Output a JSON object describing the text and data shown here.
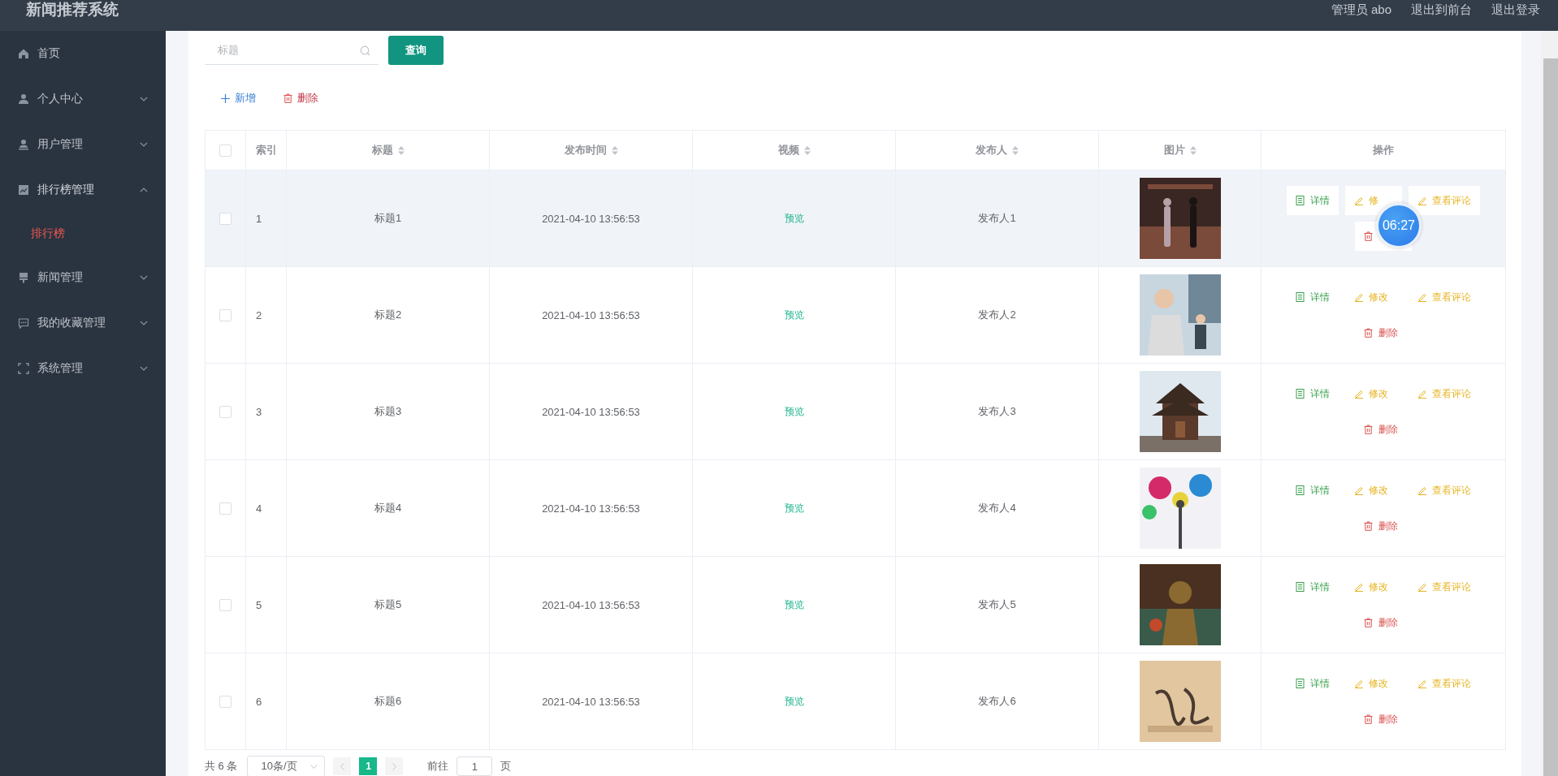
{
  "header": {
    "title": "新闻推荐系统",
    "links": [
      {
        "label": "管理员 abo"
      },
      {
        "label": "退出到前台"
      },
      {
        "label": "退出登录"
      }
    ]
  },
  "sidebar": {
    "items": [
      {
        "label": "首页",
        "expandable": false
      },
      {
        "label": "个人中心",
        "expandable": true,
        "expanded": false
      },
      {
        "label": "用户管理",
        "expandable": true,
        "expanded": false
      },
      {
        "label": "排行榜管理",
        "expandable": true,
        "expanded": true,
        "children": [
          {
            "label": "排行榜",
            "selected": true
          }
        ]
      },
      {
        "label": "新闻管理",
        "expandable": true,
        "expanded": false
      },
      {
        "label": "我的收藏管理",
        "expandable": true,
        "expanded": false
      },
      {
        "label": "系统管理",
        "expandable": true,
        "expanded": false
      }
    ]
  },
  "search": {
    "placeholder": "标题",
    "button": "查询"
  },
  "toolbar": [
    {
      "kind": "add",
      "label": "新增"
    },
    {
      "kind": "delete",
      "label": "删除"
    }
  ],
  "table": {
    "select_all": {
      "checked": false
    },
    "columns": [
      {
        "label": "索引",
        "sortable": false
      },
      {
        "label": "标题",
        "sortable": true
      },
      {
        "label": "发布时间",
        "sortable": true
      },
      {
        "label": "视频",
        "sortable": true
      },
      {
        "label": "发布人",
        "sortable": true
      },
      {
        "label": "图片",
        "sortable": true
      },
      {
        "label": "操作",
        "sortable": false
      }
    ],
    "rows": [
      {
        "checked": false,
        "hovered": true,
        "index": "1",
        "title": "标题1",
        "time": "2021-04-10 13:56:53",
        "video": "预览",
        "author": "发布人1",
        "actions": [
          {
            "kind": "detail",
            "label": "详情"
          },
          {
            "kind": "edit",
            "label": "修"
          },
          {
            "kind": "comments",
            "label": "查看评论"
          },
          {
            "kind": "delete"
          }
        ]
      },
      {
        "checked": false,
        "hovered": false,
        "index": "2",
        "title": "标题2",
        "time": "2021-04-10 13:56:53",
        "video": "预览",
        "author": "发布人2",
        "actions": [
          {
            "kind": "detail",
            "label": "详情"
          },
          {
            "kind": "edit",
            "label": "修改"
          },
          {
            "kind": "comments",
            "label": "查看评论"
          },
          {
            "kind": "delete",
            "label": "删除"
          }
        ]
      },
      {
        "checked": false,
        "hovered": false,
        "index": "3",
        "title": "标题3",
        "time": "2021-04-10 13:56:53",
        "video": "预览",
        "author": "发布人3",
        "actions": [
          {
            "kind": "detail",
            "label": "详情"
          },
          {
            "kind": "edit",
            "label": "修改"
          },
          {
            "kind": "comments",
            "label": "查看评论"
          },
          {
            "kind": "delete",
            "label": "删除"
          }
        ]
      },
      {
        "checked": false,
        "hovered": false,
        "index": "4",
        "title": "标题4",
        "time": "2021-04-10 13:56:53",
        "video": "预览",
        "author": "发布人4",
        "actions": [
          {
            "kind": "detail",
            "label": "详情"
          },
          {
            "kind": "edit",
            "label": "修改"
          },
          {
            "kind": "comments",
            "label": "查看评论"
          },
          {
            "kind": "delete",
            "label": "删除"
          }
        ]
      },
      {
        "checked": false,
        "hovered": false,
        "index": "5",
        "title": "标题5",
        "time": "2021-04-10 13:56:53",
        "video": "预览",
        "author": "发布人5",
        "actions": [
          {
            "kind": "detail",
            "label": "详情"
          },
          {
            "kind": "edit",
            "label": "修改"
          },
          {
            "kind": "comments",
            "label": "查看评论"
          },
          {
            "kind": "delete",
            "label": "删除"
          }
        ]
      },
      {
        "checked": false,
        "hovered": false,
        "index": "6",
        "title": "标题6",
        "time": "2021-04-10 13:56:53",
        "video": "预览",
        "author": "发布人6",
        "actions": [
          {
            "kind": "detail",
            "label": "详情"
          },
          {
            "kind": "edit",
            "label": "修改"
          },
          {
            "kind": "comments",
            "label": "查看评论"
          },
          {
            "kind": "delete",
            "label": "删除"
          }
        ]
      }
    ]
  },
  "pagination": {
    "total": "共 6 条",
    "page_size": "10条/页",
    "pages": [
      {
        "label": "1",
        "selected": true
      }
    ],
    "goto_label": "前往",
    "goto_value": "1",
    "page_unit": "页"
  },
  "overlay": {
    "timer": "06:27"
  }
}
